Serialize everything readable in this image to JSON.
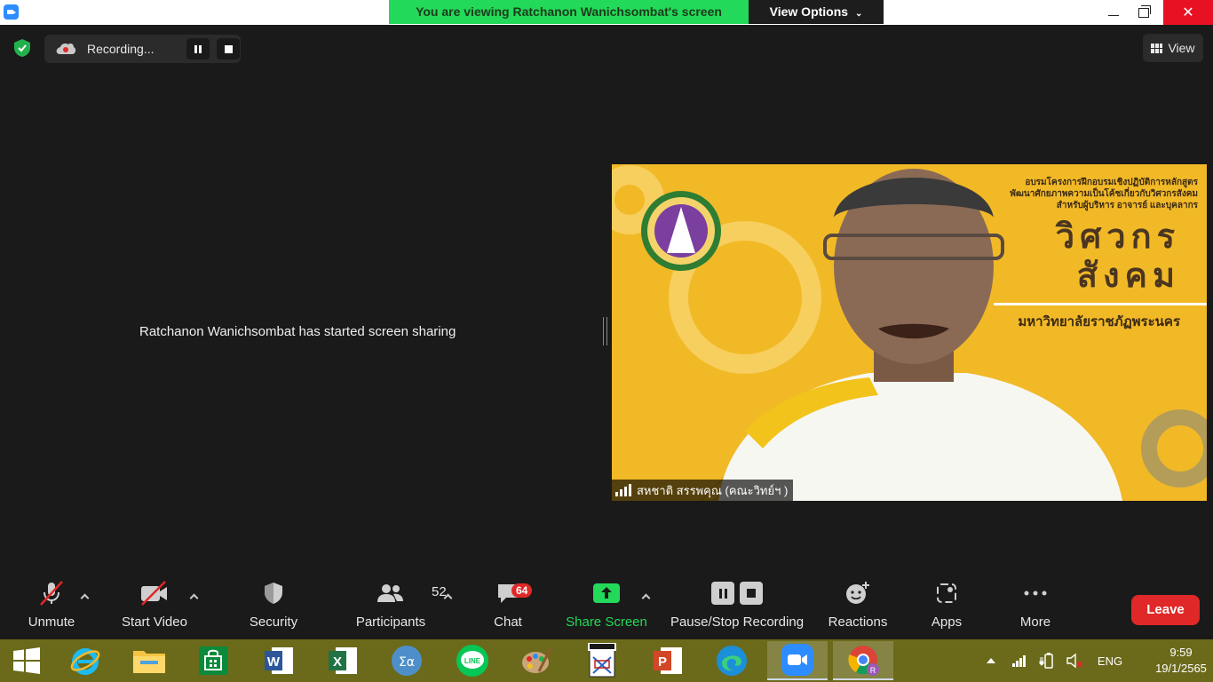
{
  "window": {
    "viewing_banner": "You are viewing Ratchanon Wanichsombat's screen",
    "view_options": "View Options"
  },
  "meeting": {
    "recording_label": "Recording...",
    "view_label": "View",
    "share_message": "Ratchanon Wanichsombat has started screen sharing"
  },
  "video": {
    "participant_name": "สหชาติ สรรพคุณ (คณะวิทย์ฯ )",
    "banner_title_line1": "อบรมโครงการฝึกอบรมเชิงปฏิบัติการหลักสูตร",
    "banner_title_line2": "พัฒนาศักยภาพความเป็นโค้ชเกี่ยวกับวิศวกรสังคม",
    "banner_title_line3": "สำหรับผู้บริหาร อาจารย์ และบุคลากร",
    "banner_big_line1": "วิศวกร",
    "banner_big_line2": "สังคม",
    "banner_university": "มหาวิทยาลัยราชภัฏพระนคร",
    "background_color": "#f2b927"
  },
  "toolbar": {
    "unmute": "Unmute",
    "start_video": "Start Video",
    "security": "Security",
    "participants": "Participants",
    "participants_count": "52",
    "chat": "Chat",
    "chat_badge": "64",
    "share_screen": "Share Screen",
    "pause_stop_recording": "Pause/Stop Recording",
    "reactions": "Reactions",
    "apps": "Apps",
    "more": "More",
    "leave": "Leave"
  },
  "taskbar": {
    "language": "ENG",
    "time": "9:59",
    "date": "19/1/2565",
    "color": "#6b6a1b"
  },
  "colors": {
    "banner_green": "#23d959",
    "leave_red": "#e02828",
    "zoom_blue": "#2d8cff"
  }
}
